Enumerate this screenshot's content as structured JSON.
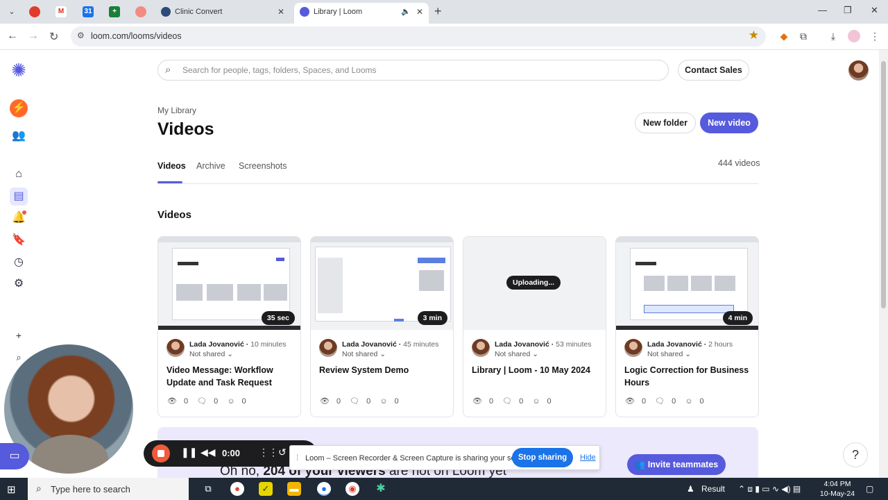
{
  "browser": {
    "tabs": [
      {
        "title": "Clinic Convert",
        "active": false
      },
      {
        "title": "Library | Loom",
        "active": true
      }
    ],
    "url": "loom.com/looms/videos"
  },
  "header": {
    "search_placeholder": "Search for people, tags, folders, Spaces, and Looms",
    "contact_sales": "Contact Sales"
  },
  "page": {
    "breadcrumb": "My Library",
    "title": "Videos",
    "new_folder": "New folder",
    "new_video": "New video",
    "tabs": [
      "Videos",
      "Archive",
      "Screenshots"
    ],
    "video_count": "444 videos",
    "section_title": "Videos"
  },
  "videos": [
    {
      "author": "Lada Jovanović",
      "time": "10 minutes",
      "sharing": "Not shared",
      "title": "Video Message: Workflow Update and Task Request",
      "duration": "35 sec",
      "views": "0",
      "comments": "0",
      "reactions": "0"
    },
    {
      "author": "Lada Jovanović",
      "time": "45 minutes",
      "sharing": "Not shared",
      "title": "Review System Demo",
      "duration": "3 min",
      "views": "0",
      "comments": "0",
      "reactions": "0"
    },
    {
      "author": "Lada Jovanović",
      "time": "53 minutes",
      "sharing": "Not shared",
      "title": "Library | Loom - 10 May 2024",
      "status": "Uploading...",
      "views": "0",
      "comments": "0",
      "reactions": "0"
    },
    {
      "author": "Lada Jovanović",
      "time": "2 hours",
      "sharing": "Not shared",
      "title": "Logic Correction for Business Hours",
      "duration": "4 min",
      "views": "0",
      "comments": "0",
      "reactions": "0"
    }
  ],
  "banner": {
    "text_prefix": "Oh no, ",
    "text_bold": "204 of your viewers",
    "text_suffix": " are not on Loom yet",
    "invite": "Invite teammates"
  },
  "recorder": {
    "time": "0:00"
  },
  "share_notice": {
    "message": "Loom – Screen Recorder & Screen Capture is sharing your screen.",
    "stop": "Stop sharing",
    "hide": "Hide"
  },
  "taskbar": {
    "search_placeholder": "Type here to search",
    "result_label": "Result",
    "time": "4:04 PM",
    "date": "10-May-24"
  },
  "colors": {
    "brand": "#565add",
    "share_blue": "#1a73e8",
    "record_red": "#f15a3a"
  }
}
